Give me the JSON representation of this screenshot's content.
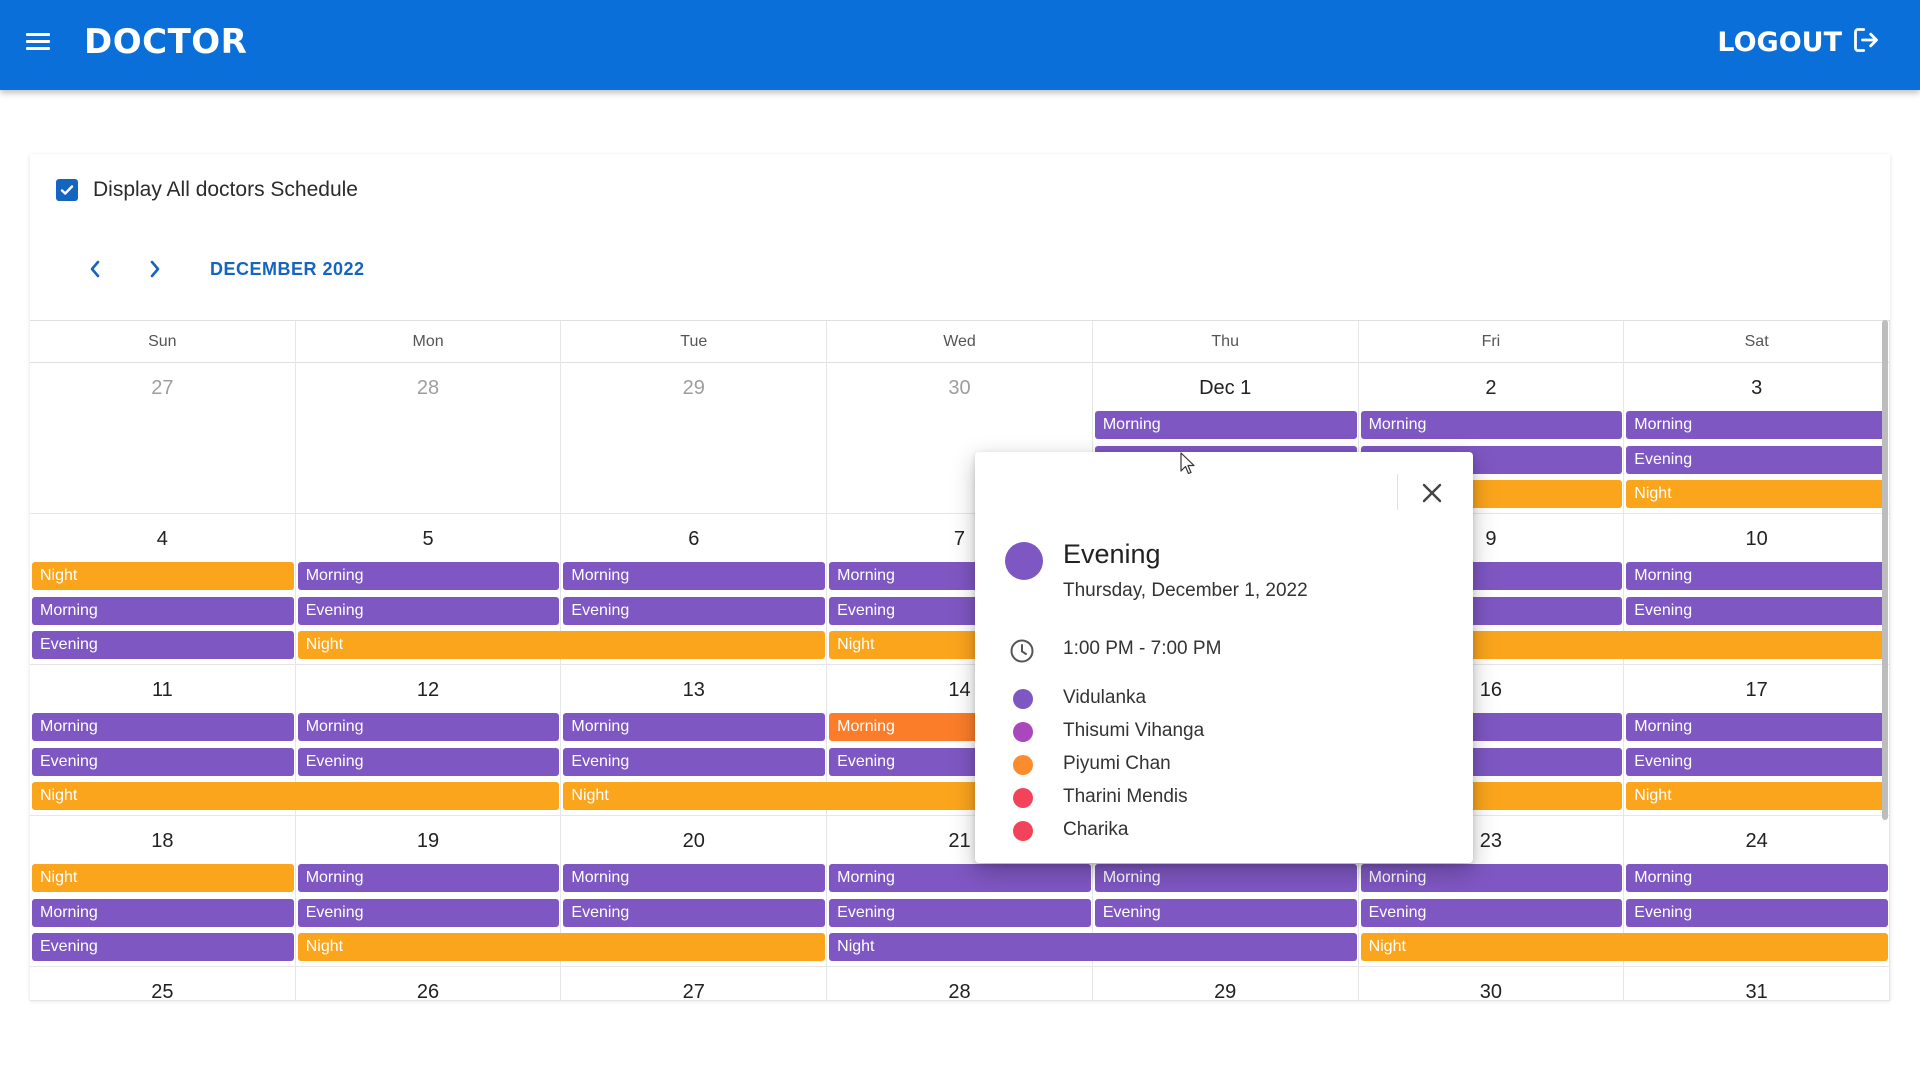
{
  "app": {
    "title": "DOCTOR",
    "logout_label": "LOGOUT",
    "brand_color": "#0b6fd9"
  },
  "filters": {
    "display_all_label": "Display All doctors Schedule",
    "display_all_checked": true
  },
  "calendar": {
    "month_label": "DECEMBER 2022",
    "weekdays": [
      "Sun",
      "Mon",
      "Tue",
      "Wed",
      "Thu",
      "Fri",
      "Sat"
    ],
    "weeks": [
      [
        "27",
        "28",
        "29",
        "30",
        "Dec 1",
        "2",
        "3"
      ],
      [
        "4",
        "5",
        "6",
        "7",
        "8",
        "9",
        "10"
      ],
      [
        "11",
        "12",
        "13",
        "14",
        "15",
        "16",
        "17"
      ],
      [
        "18",
        "19",
        "20",
        "21",
        "22",
        "23",
        "24"
      ],
      [
        "25",
        "26",
        "27",
        "28",
        "29",
        "30",
        "31"
      ]
    ],
    "muted_days": [
      [
        0,
        0
      ],
      [
        0,
        1
      ],
      [
        0,
        2
      ],
      [
        0,
        3
      ]
    ],
    "colors": {
      "Morning": "#7e57c2",
      "Evening": "#7e57c2",
      "Night": "#fba51d",
      "MorningAlt": "#fb7d29"
    },
    "events": [
      {
        "w": 0,
        "row": 0,
        "col": 4,
        "span": 1,
        "label": "Morning",
        "color": "#7e57c2"
      },
      {
        "w": 0,
        "row": 0,
        "col": 5,
        "span": 1,
        "label": "Morning",
        "color": "#7e57c2"
      },
      {
        "w": 0,
        "row": 0,
        "col": 6,
        "span": 1,
        "label": "Morning",
        "color": "#7e57c2"
      },
      {
        "w": 0,
        "row": 1,
        "col": 4,
        "span": 1,
        "label": "",
        "color": "#7e57c2"
      },
      {
        "w": 0,
        "row": 1,
        "col": 5,
        "span": 1,
        "label": "",
        "color": "#7e57c2"
      },
      {
        "w": 0,
        "row": 1,
        "col": 6,
        "span": 1,
        "label": "Evening",
        "color": "#7e57c2"
      },
      {
        "w": 0,
        "row": 2,
        "col": 5,
        "span": 1,
        "label": "",
        "color": "#fba51d"
      },
      {
        "w": 0,
        "row": 2,
        "col": 6,
        "span": 1,
        "label": "Night",
        "color": "#fba51d"
      },
      {
        "w": 1,
        "row": 0,
        "col": 0,
        "span": 1,
        "label": "Night",
        "color": "#fba51d"
      },
      {
        "w": 1,
        "row": 0,
        "col": 1,
        "span": 1,
        "label": "Morning",
        "color": "#7e57c2"
      },
      {
        "w": 1,
        "row": 0,
        "col": 2,
        "span": 1,
        "label": "Morning",
        "color": "#7e57c2"
      },
      {
        "w": 1,
        "row": 0,
        "col": 3,
        "span": 1,
        "label": "Morning",
        "color": "#7e57c2"
      },
      {
        "w": 1,
        "row": 0,
        "col": 5,
        "span": 1,
        "label": "",
        "color": "#7e57c2"
      },
      {
        "w": 1,
        "row": 0,
        "col": 6,
        "span": 1,
        "label": "Morning",
        "color": "#7e57c2"
      },
      {
        "w": 1,
        "row": 1,
        "col": 0,
        "span": 1,
        "label": "Morning",
        "color": "#7e57c2"
      },
      {
        "w": 1,
        "row": 1,
        "col": 1,
        "span": 1,
        "label": "Evening",
        "color": "#7e57c2"
      },
      {
        "w": 1,
        "row": 1,
        "col": 2,
        "span": 1,
        "label": "Evening",
        "color": "#7e57c2"
      },
      {
        "w": 1,
        "row": 1,
        "col": 3,
        "span": 1,
        "label": "Evening",
        "color": "#7e57c2"
      },
      {
        "w": 1,
        "row": 1,
        "col": 5,
        "span": 1,
        "label": "",
        "color": "#7e57c2"
      },
      {
        "w": 1,
        "row": 1,
        "col": 6,
        "span": 1,
        "label": "Evening",
        "color": "#7e57c2"
      },
      {
        "w": 1,
        "row": 2,
        "col": 0,
        "span": 1,
        "label": "Evening",
        "color": "#7e57c2"
      },
      {
        "w": 1,
        "row": 2,
        "col": 1,
        "span": 2,
        "label": "Night",
        "color": "#fba51d"
      },
      {
        "w": 1,
        "row": 2,
        "col": 3,
        "span": 4,
        "label": "Night",
        "color": "#fba51d"
      },
      {
        "w": 2,
        "row": 0,
        "col": 0,
        "span": 1,
        "label": "Morning",
        "color": "#7e57c2"
      },
      {
        "w": 2,
        "row": 0,
        "col": 1,
        "span": 1,
        "label": "Morning",
        "color": "#7e57c2"
      },
      {
        "w": 2,
        "row": 0,
        "col": 2,
        "span": 1,
        "label": "Morning",
        "color": "#7e57c2"
      },
      {
        "w": 2,
        "row": 0,
        "col": 3,
        "span": 1,
        "label": "Morning",
        "color": "#fb7d29"
      },
      {
        "w": 2,
        "row": 0,
        "col": 5,
        "span": 1,
        "label": "",
        "color": "#7e57c2"
      },
      {
        "w": 2,
        "row": 0,
        "col": 6,
        "span": 1,
        "label": "Morning",
        "color": "#7e57c2"
      },
      {
        "w": 2,
        "row": 1,
        "col": 0,
        "span": 1,
        "label": "Evening",
        "color": "#7e57c2"
      },
      {
        "w": 2,
        "row": 1,
        "col": 1,
        "span": 1,
        "label": "Evening",
        "color": "#7e57c2"
      },
      {
        "w": 2,
        "row": 1,
        "col": 2,
        "span": 1,
        "label": "Evening",
        "color": "#7e57c2"
      },
      {
        "w": 2,
        "row": 1,
        "col": 3,
        "span": 1,
        "label": "Evening",
        "color": "#7e57c2"
      },
      {
        "w": 2,
        "row": 1,
        "col": 5,
        "span": 1,
        "label": "",
        "color": "#7e57c2"
      },
      {
        "w": 2,
        "row": 1,
        "col": 6,
        "span": 1,
        "label": "Evening",
        "color": "#7e57c2"
      },
      {
        "w": 2,
        "row": 2,
        "col": 0,
        "span": 2,
        "label": "Night",
        "color": "#fba51d"
      },
      {
        "w": 2,
        "row": 2,
        "col": 2,
        "span": 2,
        "label": "Night",
        "color": "#fba51d"
      },
      {
        "w": 2,
        "row": 2,
        "col": 5,
        "span": 1,
        "label": "",
        "color": "#fba51d"
      },
      {
        "w": 2,
        "row": 2,
        "col": 6,
        "span": 1,
        "label": "Night",
        "color": "#fba51d"
      },
      {
        "w": 3,
        "row": 0,
        "col": 0,
        "span": 1,
        "label": "Night",
        "color": "#fba51d"
      },
      {
        "w": 3,
        "row": 0,
        "col": 1,
        "span": 1,
        "label": "Morning",
        "color": "#7e57c2"
      },
      {
        "w": 3,
        "row": 0,
        "col": 2,
        "span": 1,
        "label": "Morning",
        "color": "#7e57c2"
      },
      {
        "w": 3,
        "row": 0,
        "col": 3,
        "span": 1,
        "label": "Morning",
        "color": "#7e57c2"
      },
      {
        "w": 3,
        "row": 0,
        "col": 4,
        "span": 1,
        "label": "Morning",
        "color": "#7e57c2"
      },
      {
        "w": 3,
        "row": 0,
        "col": 5,
        "span": 1,
        "label": "Morning",
        "color": "#7e57c2"
      },
      {
        "w": 3,
        "row": 0,
        "col": 6,
        "span": 1,
        "label": "Morning",
        "color": "#7e57c2"
      },
      {
        "w": 3,
        "row": 1,
        "col": 0,
        "span": 1,
        "label": "Morning",
        "color": "#7e57c2"
      },
      {
        "w": 3,
        "row": 1,
        "col": 1,
        "span": 1,
        "label": "Evening",
        "color": "#7e57c2"
      },
      {
        "w": 3,
        "row": 1,
        "col": 2,
        "span": 1,
        "label": "Evening",
        "color": "#7e57c2"
      },
      {
        "w": 3,
        "row": 1,
        "col": 3,
        "span": 1,
        "label": "Evening",
        "color": "#7e57c2"
      },
      {
        "w": 3,
        "row": 1,
        "col": 4,
        "span": 1,
        "label": "Evening",
        "color": "#7e57c2"
      },
      {
        "w": 3,
        "row": 1,
        "col": 5,
        "span": 1,
        "label": "Evening",
        "color": "#7e57c2"
      },
      {
        "w": 3,
        "row": 1,
        "col": 6,
        "span": 1,
        "label": "Evening",
        "color": "#7e57c2"
      },
      {
        "w": 3,
        "row": 2,
        "col": 0,
        "span": 1,
        "label": "Evening",
        "color": "#7e57c2"
      },
      {
        "w": 3,
        "row": 2,
        "col": 1,
        "span": 2,
        "label": "Night",
        "color": "#fba51d"
      },
      {
        "w": 3,
        "row": 2,
        "col": 3,
        "span": 2,
        "label": "Night",
        "color": "#7e57c2"
      },
      {
        "w": 3,
        "row": 2,
        "col": 5,
        "span": 2,
        "label": "Night",
        "color": "#fba51d"
      }
    ]
  },
  "popover": {
    "title": "Evening",
    "date": "Thursday, December 1, 2022",
    "time": "1:00 PM - 7:00 PM",
    "color": "#7e57c2",
    "doctors": [
      {
        "name": "Vidulanka",
        "color": "#7e57c2"
      },
      {
        "name": "Thisumi Vihanga",
        "color": "#ab47bc"
      },
      {
        "name": "Piyumi Chan",
        "color": "#fb8c2e"
      },
      {
        "name": "Tharini Mendis",
        "color": "#f2435a"
      },
      {
        "name": "Charika",
        "color": "#f2435a"
      }
    ],
    "icons": {
      "close": "close-icon",
      "clock": "clock-icon"
    }
  }
}
